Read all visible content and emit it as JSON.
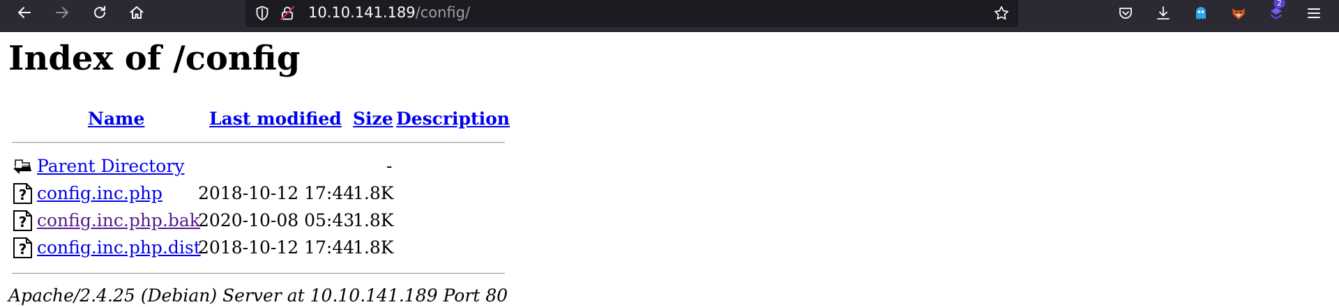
{
  "browser": {
    "url_host": "10.10.141.189",
    "url_path": "/config/",
    "extension_badge": "2",
    "icons": [
      "back-arrow-icon",
      "forward-arrow-icon",
      "reload-icon",
      "home-icon",
      "shield-icon",
      "insecure-lock-icon",
      "bookmark-star-icon",
      "pocket-icon",
      "downloads-icon",
      "ghost-extension-icon",
      "foxyproxy-extension-icon",
      "extension-icon",
      "hamburger-menu-icon"
    ]
  },
  "page": {
    "title": "Index of /config",
    "columns": {
      "name": "Name",
      "last_modified": "Last modified",
      "size": "Size",
      "description": "Description"
    },
    "rows": [
      {
        "name": "Parent Directory",
        "modified": "",
        "size": "-",
        "icon": "back-folder-icon",
        "visited": false
      },
      {
        "name": "config.inc.php",
        "modified": "2018-10-12 17:44",
        "size": "1.8K",
        "icon": "unknown-file-icon",
        "visited": false
      },
      {
        "name": "config.inc.php.bak",
        "modified": "2020-10-08 05:43",
        "size": "1.8K",
        "icon": "unknown-file-icon",
        "visited": true
      },
      {
        "name": "config.inc.php.dist",
        "modified": "2018-10-12 17:44",
        "size": "1.8K",
        "icon": "unknown-file-icon",
        "visited": false
      }
    ],
    "footer": "Apache/2.4.25 (Debian) Server at 10.10.141.189 Port 80"
  },
  "colors": {
    "link": "#0000ee",
    "visited_link": "#551a8b",
    "toolbar_bg": "#2b2a33",
    "urlbar_bg": "#1c1b22"
  }
}
